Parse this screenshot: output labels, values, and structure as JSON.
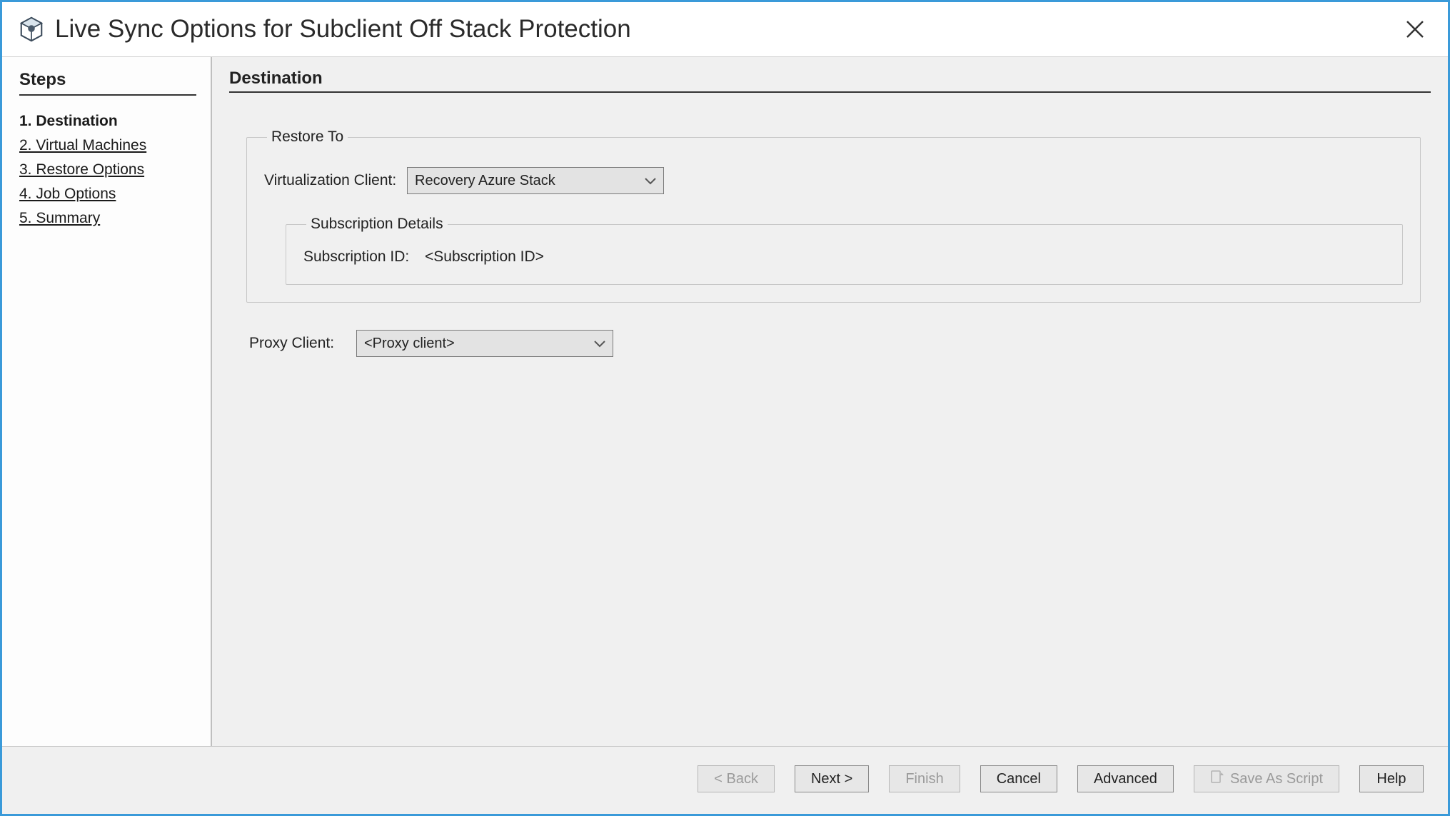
{
  "window": {
    "title": "Live Sync Options for Subclient Off Stack Protection"
  },
  "sidebar": {
    "heading": "Steps",
    "items": [
      {
        "label": "1. Destination",
        "current": true
      },
      {
        "label": "2. Virtual Machines",
        "current": false
      },
      {
        "label": "3. Restore Options",
        "current": false
      },
      {
        "label": "4. Job Options",
        "current": false
      },
      {
        "label": "5. Summary",
        "current": false
      }
    ]
  },
  "main": {
    "heading": "Destination",
    "restore_to": {
      "legend": "Restore To",
      "virtualization_client_label": "Virtualization Client:",
      "virtualization_client_value": "Recovery Azure Stack",
      "subscription_details": {
        "legend": "Subscription Details",
        "subscription_id_label": "Subscription ID:",
        "subscription_id_value": "<Subscription ID>"
      }
    },
    "proxy_client_label": "Proxy Client:",
    "proxy_client_value": "<Proxy client>"
  },
  "footer": {
    "back": "< Back",
    "next": "Next >",
    "finish": "Finish",
    "cancel": "Cancel",
    "advanced": "Advanced",
    "save_as_script": "Save As Script",
    "help": "Help"
  }
}
